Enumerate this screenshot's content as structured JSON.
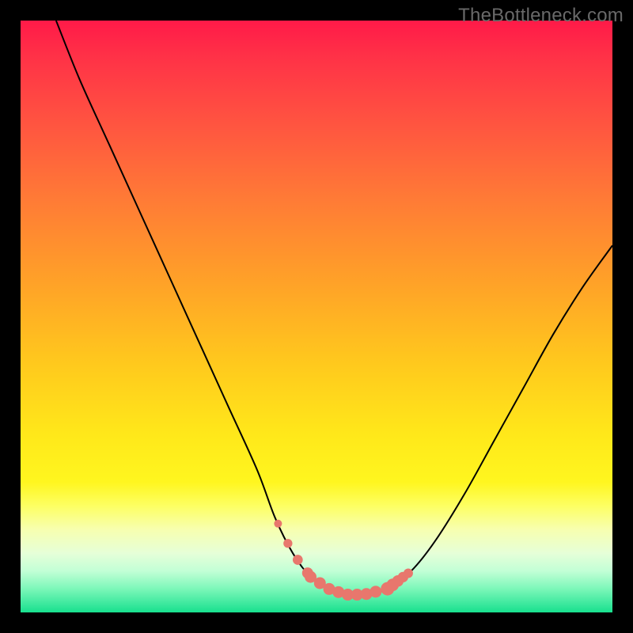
{
  "watermark": "TheBottleneck.com",
  "chart_data": {
    "type": "line",
    "title": "",
    "xlabel": "",
    "ylabel": "",
    "xlim": [
      0,
      100
    ],
    "ylim": [
      0,
      100
    ],
    "grid": false,
    "legend": false,
    "series": [
      {
        "name": "curve",
        "color": "#000000",
        "x": [
          6,
          10,
          15,
          20,
          25,
          30,
          35,
          40,
          43,
          46,
          49,
          52,
          55,
          58,
          62,
          66,
          70,
          75,
          80,
          85,
          90,
          95,
          100
        ],
        "y": [
          100,
          90,
          79,
          68,
          57,
          46,
          35,
          24,
          16,
          10,
          6,
          4,
          3,
          3,
          4,
          7,
          12,
          20,
          29,
          38,
          47,
          55,
          62
        ]
      }
    ],
    "flat_band": {
      "y": 3,
      "x_from": 52,
      "x_to": 58
    },
    "gradient_stops": [
      {
        "pos": 0.0,
        "color": "#ff1a48"
      },
      {
        "pos": 0.7,
        "color": "#ffe81a"
      },
      {
        "pos": 0.82,
        "color": "#fdff63"
      },
      {
        "pos": 1.0,
        "color": "#18e08e"
      }
    ],
    "beads": {
      "color": "#e8776d",
      "left": {
        "x_from": 43.5,
        "x_to": 48.5,
        "count": 4
      },
      "flat": {
        "x_from": 49,
        "x_to": 60,
        "count": 8
      },
      "right": {
        "x_from": 62,
        "x_to": 65.5,
        "count": 5
      }
    }
  }
}
